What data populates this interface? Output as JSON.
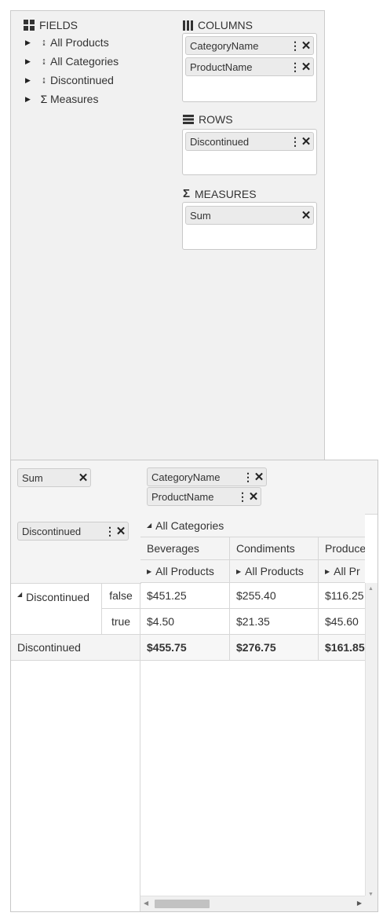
{
  "configurator": {
    "fields_title": "FIELDS",
    "fields": [
      {
        "label": "All Products",
        "icon": "hierarchy-icon"
      },
      {
        "label": "All Categories",
        "icon": "hierarchy-icon"
      },
      {
        "label": "Discontinued",
        "icon": "hierarchy-icon"
      },
      {
        "label": "Measures",
        "icon": "sigma-icon"
      }
    ],
    "columns_title": "COLUMNS",
    "columns": [
      "CategoryName",
      "ProductName"
    ],
    "rows_title": "ROWS",
    "rows": [
      "Discontinued"
    ],
    "measures_title": "MEASURES",
    "measures": [
      "Sum"
    ]
  },
  "pivot": {
    "measure_chip": "Sum",
    "column_chips": [
      "CategoryName",
      "ProductName"
    ],
    "row_chip": "Discontinued",
    "all_categories": "All Categories",
    "categories": [
      "Beverages",
      "Condiments",
      "Produce"
    ],
    "all_products": [
      "All Products",
      "All Products",
      "All Pr"
    ],
    "row_group": "Discontinued",
    "rows": [
      {
        "label": "false",
        "values": [
          "$451.25",
          "$255.40",
          "$116.25"
        ]
      },
      {
        "label": "true",
        "values": [
          "$4.50",
          "$21.35",
          "$45.60"
        ]
      }
    ],
    "total_label": "Discontinued",
    "totals": [
      "$455.75",
      "$276.75",
      "$161.85"
    ]
  }
}
